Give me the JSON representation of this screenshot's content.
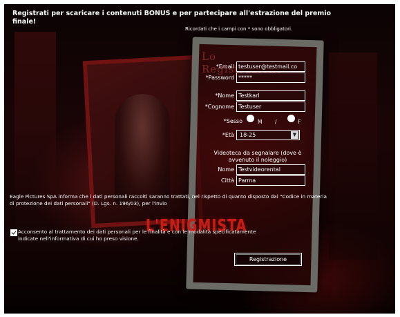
{
  "header": {
    "title": "Registrati per scaricare i contenuti BONUS e per partecipare all'estrazione del premio finale!",
    "required_note": "Ricordati che i campi con * sono obbligatori."
  },
  "background": {
    "form_ghost_title": "Lo Registrazione",
    "logo_text": "L'ENIGMISTA"
  },
  "form": {
    "email": {
      "label": "*Email",
      "value": "testuser@testmail.co"
    },
    "password": {
      "label": "*Password",
      "value": "*****"
    },
    "nome": {
      "label": "*Nome",
      "value": "Testkarl"
    },
    "cognome": {
      "label": "*Cognome",
      "value": "Testuser"
    },
    "sesso": {
      "label": "*Sesso",
      "option_m": "M",
      "separator": "/",
      "option_f": "F",
      "selected": "M"
    },
    "eta": {
      "label": "*Età",
      "value": "18-25"
    },
    "videoteca": {
      "heading": "Videoteca da segnalare (dove è avvenuto il noleggio)",
      "nome": {
        "label": "Nome",
        "value": "Testvideorental"
      },
      "citta": {
        "label": "Città",
        "value": "Parma"
      }
    }
  },
  "privacy_text": "Eagle Pictures SpA informa che i dati personali raccolti saranno trattati, nel rispetto di quanto disposto dal \"Codice in materia di protezione dei dati personali\" (D. Lgs. n. 196/03), per l'invio",
  "consent": {
    "checked": true,
    "text": "Acconsento al trattamento dei dati personali per le finalità e con le modalità specificatamente indicate nell'informativa di cui ho preso visione."
  },
  "submit_label": "Registrazione",
  "colors": {
    "background": "#070203",
    "accent_red": "#c21e16",
    "field_bg": "#2a0708",
    "text": "#ffffff"
  }
}
